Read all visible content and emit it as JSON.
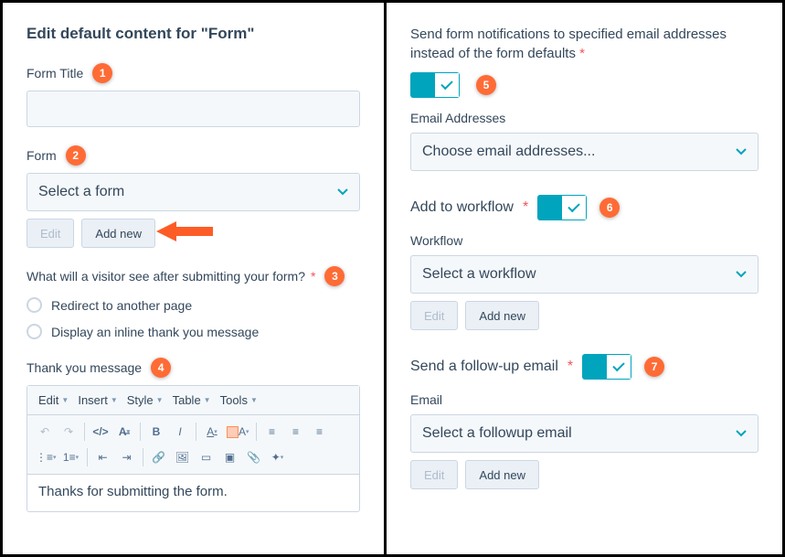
{
  "left": {
    "heading": "Edit default content for \"Form\"",
    "formTitle": {
      "label": "Form Title",
      "value": ""
    },
    "form": {
      "label": "Form",
      "placeholder": "Select a form",
      "editBtn": "Edit",
      "addBtn": "Add new"
    },
    "afterSubmit": {
      "label": "What will a visitor see after submitting your form?",
      "options": [
        "Redirect to another page",
        "Display an inline thank you message"
      ]
    },
    "thankYou": {
      "label": "Thank you message"
    },
    "rte": {
      "menus": [
        "Edit",
        "Insert",
        "Style",
        "Table",
        "Tools"
      ],
      "body": "Thanks for submitting the form."
    }
  },
  "right": {
    "notify": {
      "label": "Send form notifications to specified email addresses instead of the form defaults",
      "on": true
    },
    "emailAddresses": {
      "label": "Email Addresses",
      "placeholder": "Choose email addresses..."
    },
    "workflow": {
      "toggleLabel": "Add to workflow",
      "label": "Workflow",
      "placeholder": "Select a workflow",
      "editBtn": "Edit",
      "addBtn": "Add new"
    },
    "followup": {
      "toggleLabel": "Send a follow-up email",
      "label": "Email",
      "placeholder": "Select a followup email",
      "editBtn": "Edit",
      "addBtn": "Add new"
    }
  },
  "annotations": [
    "1",
    "2",
    "3",
    "4",
    "5",
    "6",
    "7"
  ]
}
